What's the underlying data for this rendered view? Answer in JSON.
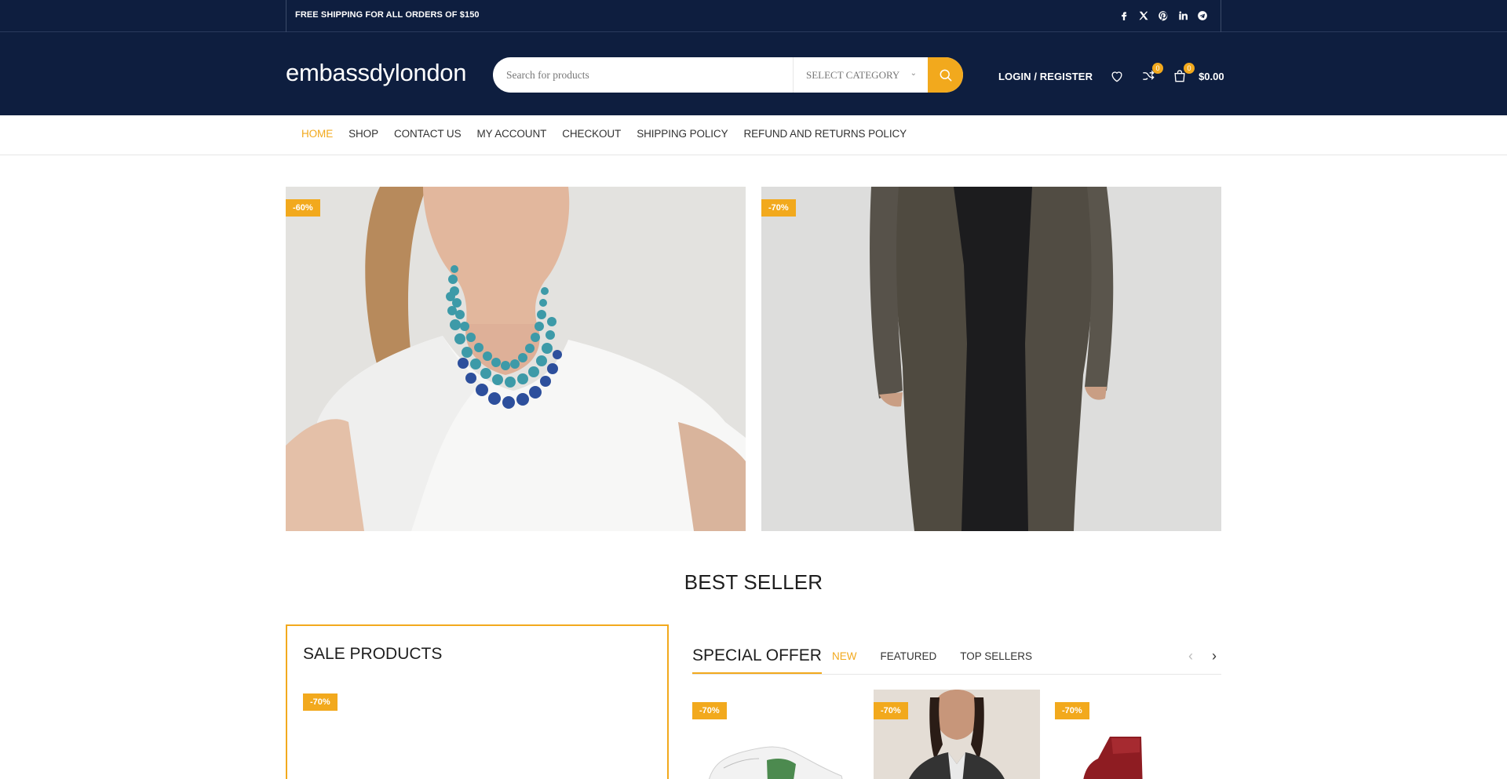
{
  "topbar": {
    "shipping_text": "FREE SHIPPING FOR ALL ORDERS OF $150",
    "socials": [
      "facebook-icon",
      "x-icon",
      "pinterest-icon",
      "linkedin-icon",
      "telegram-icon"
    ]
  },
  "header": {
    "logo": "embassdylondon",
    "search_placeholder": "Search for products",
    "category_label": "SELECT CATEGORY",
    "login_label": "LOGIN / REGISTER",
    "compare_count": "0",
    "cart_count": "0",
    "cart_total": "$0.00"
  },
  "nav": {
    "items": [
      "HOME",
      "SHOP",
      "CONTACT US",
      "MY ACCOUNT",
      "CHECKOUT",
      "SHIPPING POLICY",
      "REFUND AND RETURNS POLICY"
    ],
    "active_index": 0
  },
  "banners": [
    {
      "discount": "-60%"
    },
    {
      "discount": "-70%"
    }
  ],
  "best_seller": {
    "title": "BEST SELLER"
  },
  "sale_products": {
    "title": "SALE PRODUCTS",
    "discount": "-70%"
  },
  "special_offer": {
    "title": "SPECIAL OFFER",
    "tabs": [
      "NEW",
      "FEATURED",
      "TOP SELLERS"
    ],
    "active_tab": 0,
    "products": [
      {
        "discount": "-70%"
      },
      {
        "discount": "-70%"
      },
      {
        "discount": "-70%"
      }
    ]
  },
  "colors": {
    "navy": "#0e1e3f",
    "accent": "#f2a91d"
  }
}
